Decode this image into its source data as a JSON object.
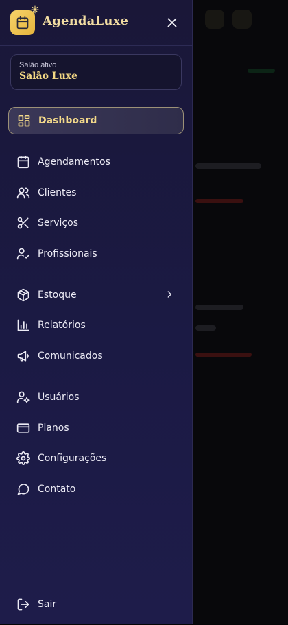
{
  "brand": {
    "name": "AgendaLuxe"
  },
  "salon": {
    "label": "Salão ativo",
    "name": "Salão Luxe"
  },
  "nav": [
    {
      "label": "Dashboard",
      "icon": "dashboard-icon",
      "active": true
    },
    {
      "label": "Agendamentos",
      "icon": "calendar-icon"
    },
    {
      "label": "Clientes",
      "icon": "users-icon"
    },
    {
      "label": "Serviços",
      "icon": "scissors-icon"
    },
    {
      "label": "Profissionais",
      "icon": "user-check-icon"
    },
    {
      "label": "Estoque",
      "icon": "package-icon",
      "has_submenu": true
    },
    {
      "label": "Relatórios",
      "icon": "bar-chart-icon"
    },
    {
      "label": "Comunicados",
      "icon": "megaphone-icon"
    },
    {
      "label": "Usuários",
      "icon": "user-cog-icon"
    },
    {
      "label": "Planos",
      "icon": "credit-card-icon"
    },
    {
      "label": "Configurações",
      "icon": "gear-icon"
    },
    {
      "label": "Contato",
      "icon": "message-circle-icon"
    }
  ],
  "footer": {
    "logout_label": "Sair",
    "icon": "logout-icon"
  },
  "colors": {
    "accent": "#f0c65a",
    "drawer_bg": "#1b1a44",
    "text": "#ecebf5",
    "active_text": "#f3d98a"
  }
}
